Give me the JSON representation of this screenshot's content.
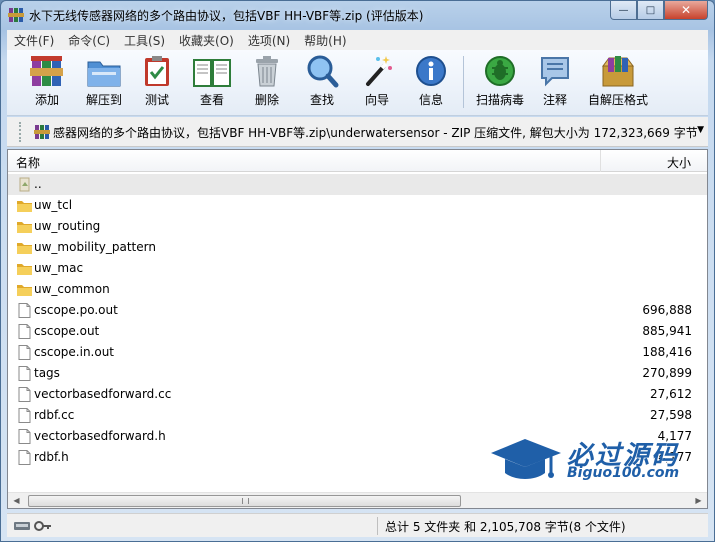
{
  "window": {
    "title": "水下无线传感器网络的多个路由协议，包括VBF HH-VBF等.zip (评估版本)",
    "controls": {
      "minimize": "—",
      "maximize": "□",
      "close": "✕"
    }
  },
  "menu": [
    "文件(F)",
    "命令(C)",
    "工具(S)",
    "收藏夹(O)",
    "选项(N)",
    "帮助(H)"
  ],
  "toolbar": [
    {
      "label": "添加",
      "icon": "add-archive-icon"
    },
    {
      "label": "解压到",
      "icon": "extract-to-icon"
    },
    {
      "label": "测试",
      "icon": "test-clipboard-icon"
    },
    {
      "label": "查看",
      "icon": "view-book-icon"
    },
    {
      "label": "删除",
      "icon": "trash-can-icon"
    },
    {
      "label": "查找",
      "icon": "magnifier-icon"
    },
    {
      "label": "向导",
      "icon": "wizard-wand-icon"
    },
    {
      "label": "信息",
      "icon": "info-icon"
    },
    {
      "label": "扫描病毒",
      "icon": "virus-scan-icon"
    },
    {
      "label": "注释",
      "icon": "comment-icon"
    },
    {
      "label": "自解压格式",
      "icon": "sfx-box-icon"
    }
  ],
  "address": {
    "path": "感器网络的多个路由协议，包括VBF HH-VBF等.zip\\underwatersensor - ZIP 压缩文件, 解包大小为 172,323,669 字节",
    "dropdown": "▼"
  },
  "columns": {
    "name": "名称",
    "size": "大小"
  },
  "files": [
    {
      "name": "..",
      "size": "",
      "type": "parent",
      "selected": true
    },
    {
      "name": "uw_tcl",
      "size": "",
      "type": "folder"
    },
    {
      "name": "uw_routing",
      "size": "",
      "type": "folder"
    },
    {
      "name": "uw_mobility_pattern",
      "size": "",
      "type": "folder"
    },
    {
      "name": "uw_mac",
      "size": "",
      "type": "folder"
    },
    {
      "name": "uw_common",
      "size": "",
      "type": "folder"
    },
    {
      "name": "cscope.po.out",
      "size": "696,888",
      "type": "file"
    },
    {
      "name": "cscope.out",
      "size": "885,941",
      "type": "file"
    },
    {
      "name": "cscope.in.out",
      "size": "188,416",
      "type": "file"
    },
    {
      "name": "tags",
      "size": "270,899",
      "type": "file"
    },
    {
      "name": "vectorbasedforward.cc",
      "size": "27,612",
      "type": "file"
    },
    {
      "name": "rdbf.cc",
      "size": "27,598",
      "type": "file"
    },
    {
      "name": "vectorbasedforward.h",
      "size": "4,177",
      "type": "file"
    },
    {
      "name": "rdbf.h",
      "size": "4,177",
      "type": "file"
    }
  ],
  "hscroll": {
    "left": "◀",
    "right": "▶"
  },
  "status": {
    "text": "总计 5 文件夹 和 2,105,708 字节(8 个文件)"
  },
  "watermark": {
    "title": "必过源码",
    "subtitle": "Biguo100.com"
  },
  "colors": {
    "accent": "#1f5fa8",
    "folder": "#f2c94c",
    "titlebar": "#b9d1ea"
  }
}
